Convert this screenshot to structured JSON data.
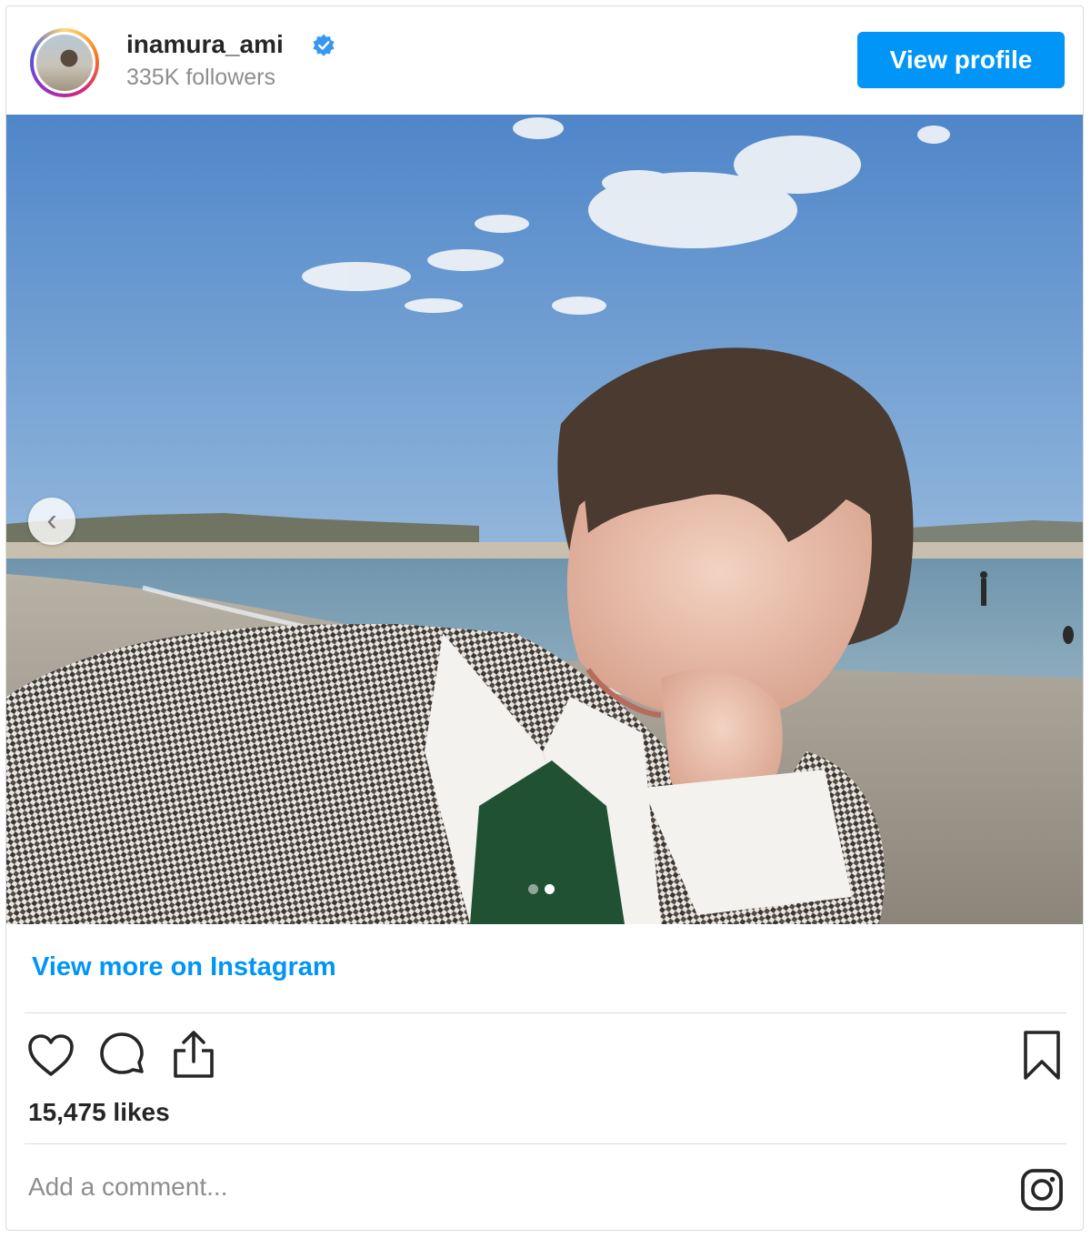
{
  "header": {
    "username": "inamura_ami",
    "followers": "335K followers",
    "view_profile_label": "View profile"
  },
  "post": {
    "photo_icon": "carousel-photo",
    "carousel": {
      "total": 2,
      "current": 2
    },
    "view_more_label": "View more on Instagram",
    "likes": "15,475 likes"
  },
  "comment": {
    "placeholder": "Add a comment..."
  },
  "colors": {
    "accent": "#0095f6",
    "text": "#262626",
    "muted": "#8e8e8e",
    "border": "#dbdbdb",
    "verified": "#3897f0"
  }
}
